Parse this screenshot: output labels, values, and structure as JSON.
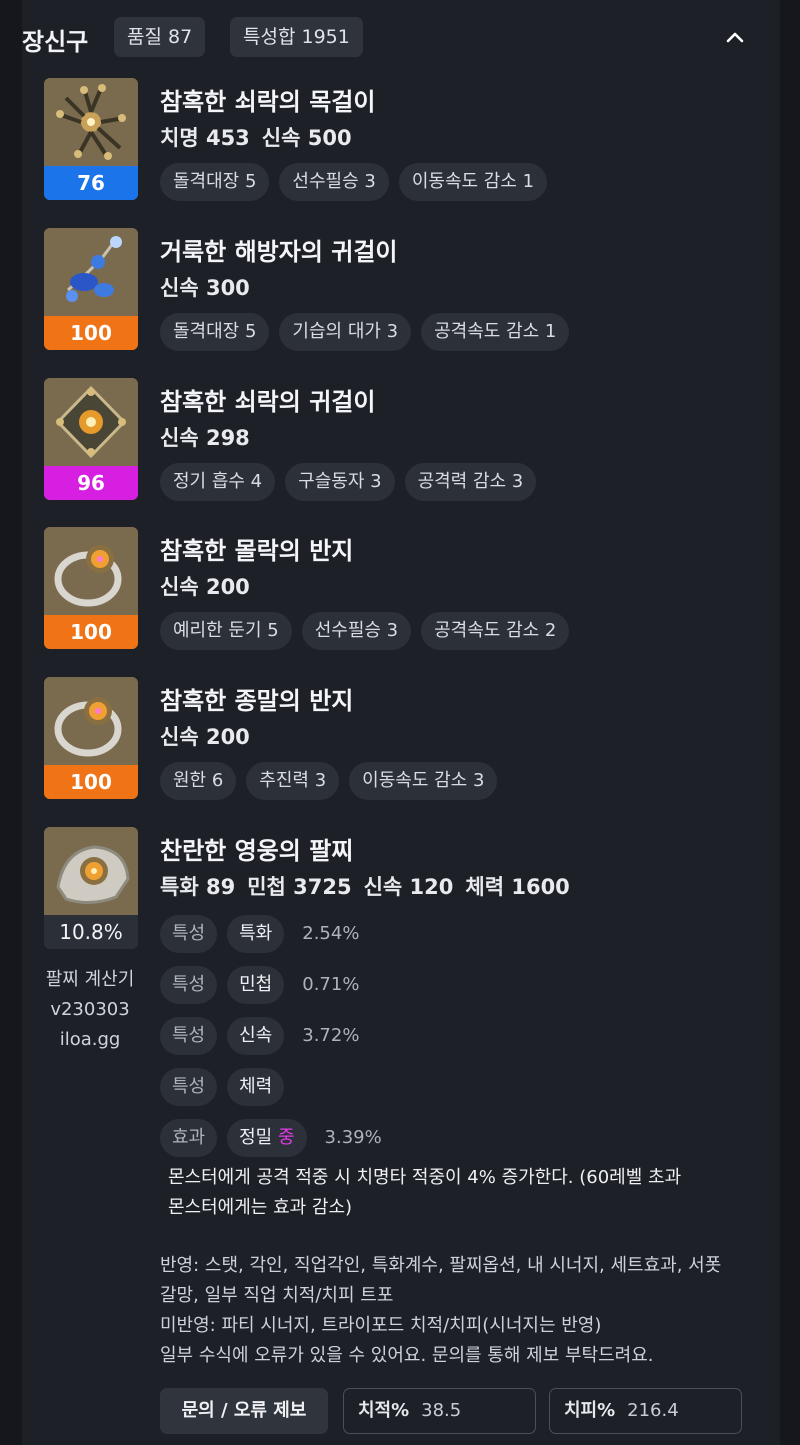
{
  "header": {
    "title": "장신구",
    "quality": "품질 87",
    "engraving_sum": "특성합 1951"
  },
  "colors": {
    "quality_blue": "#1c74ea",
    "quality_orange": "#f07416",
    "quality_magenta": "#d61fe0",
    "accent_magenta": "#e23ce6"
  },
  "items": [
    {
      "name": "참혹한 쇠락의 목걸이",
      "quality": "76",
      "stats": [
        "치명 453",
        "신속 500"
      ],
      "chips": [
        "돌격대장 5",
        "선수필승 3",
        "이동속도 감소 1"
      ]
    },
    {
      "name": "거룩한 해방자의 귀걸이",
      "quality": "100",
      "stats": [
        "신속 300"
      ],
      "chips": [
        "돌격대장 5",
        "기습의 대가 3",
        "공격속도 감소 1"
      ]
    },
    {
      "name": "참혹한 쇠락의 귀걸이",
      "quality": "96",
      "stats": [
        "신속 298"
      ],
      "chips": [
        "정기 흡수 4",
        "구슬동자 3",
        "공격력 감소 3"
      ]
    },
    {
      "name": "참혹한 몰락의 반지",
      "quality": "100",
      "stats": [
        "신속 200"
      ],
      "chips": [
        "예리한 둔기 5",
        "선수필승 3",
        "공격속도 감소 2"
      ]
    },
    {
      "name": "참혹한 종말의 반지",
      "quality": "100",
      "stats": [
        "신속 200"
      ],
      "chips": [
        "원한 6",
        "추진력 3",
        "이동속도 감소 3"
      ]
    }
  ],
  "bracelet": {
    "name": "찬란한 영웅의 팔찌",
    "percent": "10.8%",
    "stats": [
      "특화 89",
      "민첩 3725",
      "신속 120",
      "체력 1600"
    ],
    "calc_lines": [
      "팔찌 계산기",
      "v230303",
      "iloa.gg"
    ],
    "rows": [
      {
        "type": "특성",
        "stat": "특화",
        "value": "2.54%"
      },
      {
        "type": "특성",
        "stat": "민첩",
        "value": "0.71%"
      },
      {
        "type": "특성",
        "stat": "신속",
        "value": "3.72%"
      },
      {
        "type": "특성",
        "stat": "체력",
        "value": ""
      }
    ],
    "effect_row": {
      "type": "효과",
      "stat": "정밀",
      "grade": "중",
      "value": "3.39%"
    },
    "effect_text_1": "몬스터에게 공격 적중 시 치명타 적중이 4% 증가한다. (60레벨 초과",
    "effect_text_2": "몬스터에게는 효과 감소)"
  },
  "notes": [
    "반영: 스탯, 각인, 직업각인, 특화계수, 팔찌옵션, 내 시너지, 세트효과, 서폿",
    "갈망, 일부 직업 치적/치피 트포",
    "미반영: 파티 시너지, 트라이포드 치적/치피(시너지는 반영)",
    "일부 수식에 오류가 있을 수 있어요. 문의를 통해 제보 부탁드려요."
  ],
  "footer": {
    "report_label": "문의 / 오류 제보",
    "crit_label": "치적%",
    "crit_value": "38.5",
    "critdmg_label": "치피%",
    "critdmg_value": "216.4"
  }
}
